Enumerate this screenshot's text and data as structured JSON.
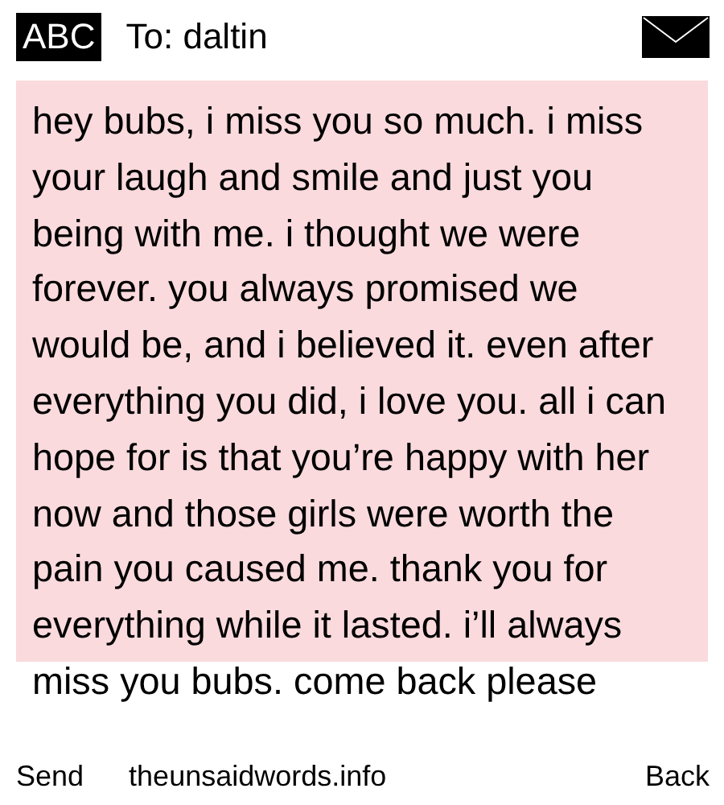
{
  "header": {
    "mode_badge": "ABC",
    "recipient": "To: daltin"
  },
  "message": {
    "text": "hey bubs, i miss you so much. i miss your laugh and smile and just you being with me. i thought we were forever. you always promised we would be, and i believed it. even after everything you did, i love you. all i can hope for is that you’re happy with her now and those girls were worth the pain you caused me. thank you for everything while it lasted. i’ll always miss you bubs. come back please"
  },
  "softkeys": {
    "left": "Send",
    "center": "theunsaidwords.info",
    "right": "Back"
  }
}
